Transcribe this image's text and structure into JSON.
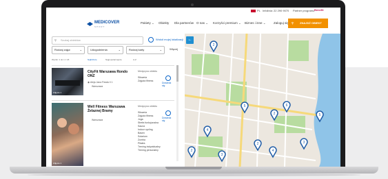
{
  "topbar": {
    "lang": "PL",
    "phone": "Infolinia: 22 290 9070",
    "partner": "Partner programu",
    "brand2": "Benefit"
  },
  "nav": {
    "logo": "MEDICOVER",
    "logo_sub": "SPORT",
    "menu": [
      "Pakiety ⌄",
      "Obiekty",
      "Dla partnerów",
      "O nas ⌄",
      "Korzyści premium ⌄",
      "Biznes i inne ⌄"
    ],
    "login": "Zaloguj się",
    "cta": "ZNAJDŹ OBIEKT"
  },
  "left": {
    "search_placeholder": "Szukaj obiektów",
    "nearby": "Wokół mojej lokalizacji",
    "filters": [
      "Rodzaj zajęć",
      "Udogodnienia",
      "Rodzaj karty"
    ],
    "more": "Więcej",
    "sort_label": "Wyniki: 1 do 1 z 18",
    "sort_options": [
      "Najbliższe",
      "Najpopularniejsze",
      "A-Z"
    ],
    "cards": [
      {
        "name": "CityFit Warszawa Rondo ONZ",
        "address": "Aleja Jana Pawła II 1",
        "city": "Warszawa",
        "heading": "Medycyna obiektu",
        "activities": [
          "Siłownia",
          "Zajęcia fitness"
        ],
        "more": "Dowiedz się",
        "badge": "Zdjęcie 1"
      },
      {
        "name": "Well Fitness Warszawa Żelaznej Bramy",
        "address": "",
        "city": "Warszawa",
        "heading": "Medycyna obiektu",
        "activities": [
          "Siłownia",
          "Zajęcia fitness",
          "Joga",
          "Strefa funkcjonalna",
          "Sauna",
          "Indoor cycling",
          "Basen",
          "Solarium",
          "Zumba",
          "Pilates",
          "Trening indywidualny",
          "Trening personalny"
        ],
        "more": "Dowiedz się",
        "badge": "Zdjęcie 1"
      }
    ]
  },
  "map": {
    "pin_labels": [
      "2",
      "5",
      "6",
      "2",
      "4",
      "3",
      "2",
      "4",
      "2",
      "3",
      "5"
    ],
    "colors": {
      "pin": "#1c5aa6",
      "river": "#8fc4e8",
      "park": "#b8dca0",
      "road": "#ffffff",
      "main_road": "#f6d97a"
    }
  }
}
